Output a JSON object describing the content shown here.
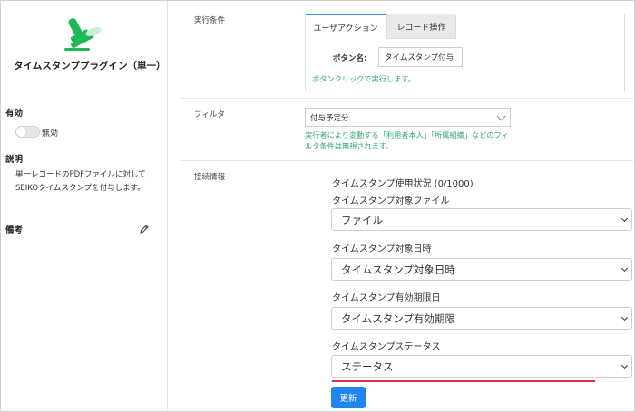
{
  "sidebar": {
    "plugin_title": "タイムスタンププラグイン（単一）",
    "enabled_heading": "有効",
    "toggle_label": "無効",
    "description_heading": "説明",
    "description_text": "単一レコードのPDFファイルに対して SEIKOタイムスタンプを付与します。",
    "notes_heading": "備考",
    "icons": {
      "logo": "stamp-icon",
      "edit": "pencil-icon"
    }
  },
  "main": {
    "execution": {
      "label": "実行条件",
      "tabs": [
        {
          "label": "ユーザアクション",
          "active": true
        },
        {
          "label": "レコード操作",
          "active": false
        }
      ],
      "button_name_label": "ボタン名:",
      "button_name_value": "タイムスタンプ付与",
      "note": "ボタンクリックで実行します。"
    },
    "filter": {
      "label": "フィルタ",
      "select_value": "付与予定分",
      "note": "実行者により変動する「利用者本人」「所属組織」などのフィルタ条件は無視されます。"
    },
    "connection": {
      "label": "接続情報",
      "usage": "タイムスタンプ使用状況 (0/1000)",
      "fields": [
        {
          "label": "タイムスタンプ対象ファイル",
          "value": "ファイル"
        },
        {
          "label": "タイムスタンプ対象日時",
          "value": "タイムスタンプ対象日時"
        },
        {
          "label": "タイムスタンプ有効期限日",
          "value": "タイムスタンプ有効期限"
        },
        {
          "label": "タイムスタンプステータス",
          "value": "ステータス"
        }
      ],
      "update_button": "更新"
    }
  },
  "colors": {
    "accent_blue": "#1f86f0",
    "note_green": "#3aa876",
    "highlight_red": "#d9363e",
    "logo_green": "#1db954"
  }
}
